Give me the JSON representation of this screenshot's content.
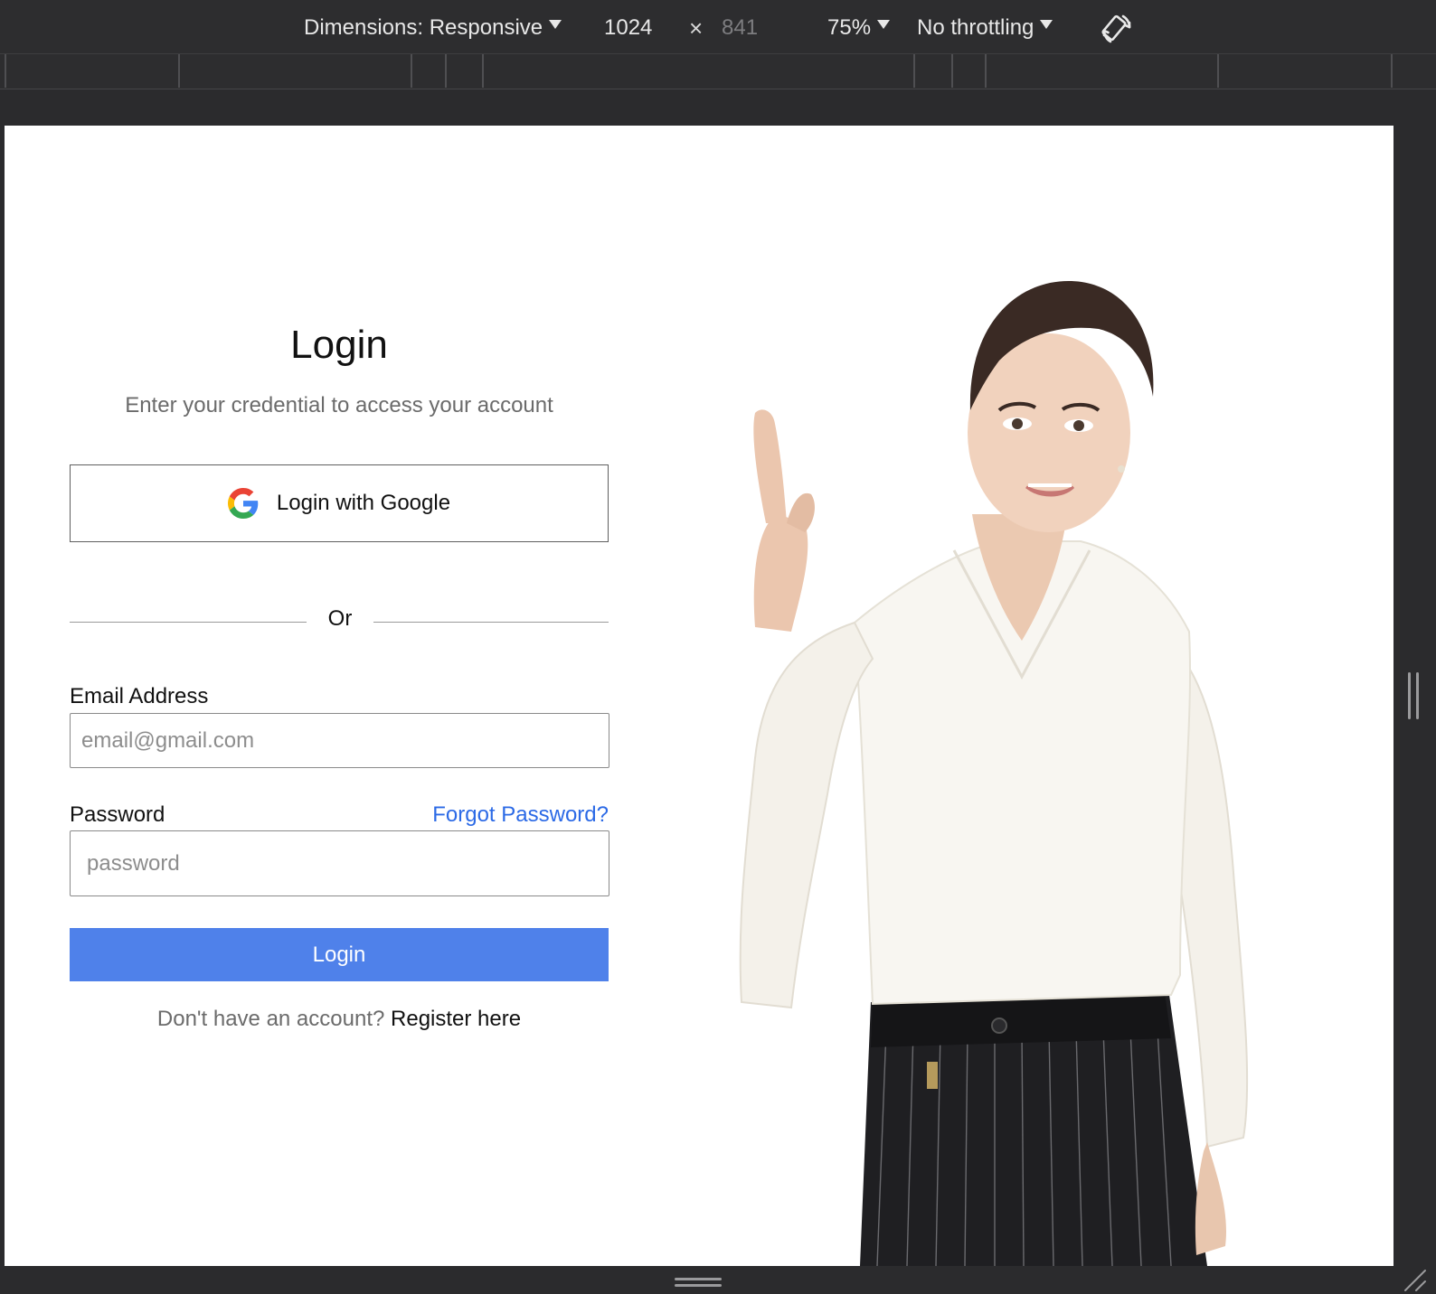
{
  "devtools": {
    "dimensions_label": "Dimensions: Responsive",
    "width_value": "1024",
    "times_symbol": "×",
    "height_value": "841",
    "zoom_label": "75%",
    "throttling_label": "No throttling",
    "rotate_icon": "rotate-icon"
  },
  "login": {
    "title": "Login",
    "subtitle": "Enter your credential to access your account",
    "google_button_label": "Login with Google",
    "google_icon": "google-logo-icon",
    "divider_text": "Or",
    "email_label": "Email Address",
    "email_placeholder": "email@gmail.com",
    "password_label": "Password",
    "forgot_password_label": "Forgot Password?",
    "password_placeholder": "password",
    "login_button_label": "Login",
    "register_prompt": "Don't have an account?",
    "register_link_label": "Register here"
  },
  "colors": {
    "primary_button": "#4f81ea",
    "link": "#2c6ae6",
    "devtools_background": "#2d2d2f",
    "page_background": "#ffffff"
  },
  "hero_image": {
    "icon": "woman-pointing-up-image"
  }
}
